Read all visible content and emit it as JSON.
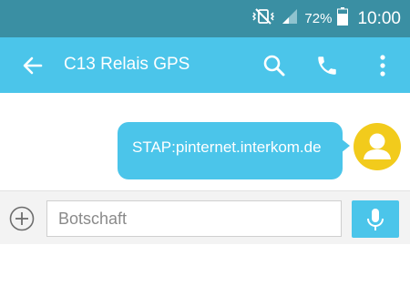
{
  "status_bar": {
    "battery_percent": "72%",
    "time": "10:00",
    "icons": [
      "vibrate-mute-icon",
      "signal-icon",
      "battery-icon"
    ]
  },
  "app_bar": {
    "title": "C13 Relais GPS",
    "icons": [
      "back-arrow-icon",
      "search-icon",
      "phone-icon",
      "more-vert-icon"
    ]
  },
  "messages": [
    {
      "text": "STAP:pinternet.interkom.de",
      "direction": "outgoing"
    }
  ],
  "compose": {
    "placeholder": "Botschaft",
    "value": "",
    "icons": [
      "add-circle-icon",
      "mic-icon"
    ]
  },
  "colors": {
    "status_bar": "#3a8fa3",
    "app_bar": "#4bc5ea",
    "bubble": "#4bc5ea",
    "avatar": "#f2cb1c"
  }
}
